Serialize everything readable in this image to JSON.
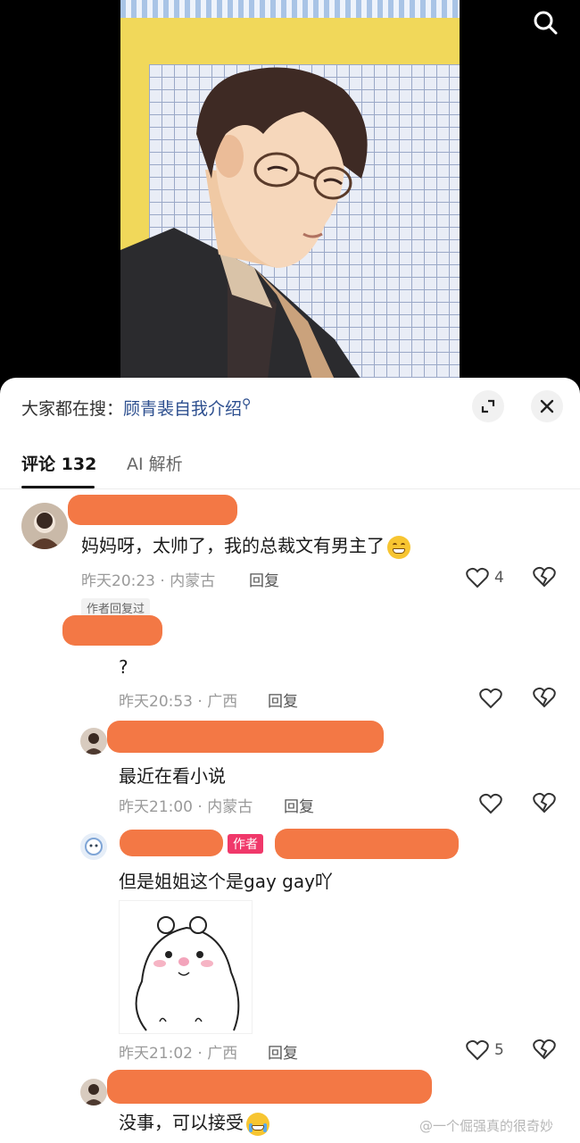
{
  "search_bar": {
    "prefix": "大家都在搜：",
    "keyword": "顾青裴自我介绍",
    "search_mark": "⚲"
  },
  "tabs": {
    "comments_label": "评论",
    "comments_count": "132",
    "ai_label": "AI 解析"
  },
  "comments": [
    {
      "text": "妈妈呀，太帅了，我的总裁文有男主了",
      "emoji": "grinning-face",
      "time": "昨天20:23",
      "location": "内蒙古",
      "reply_label": "回复",
      "likes": "4",
      "author_replied_tag": "作者回复过"
    },
    {
      "text": "?",
      "time": "昨天20:53",
      "location": "广西",
      "reply_label": "回复",
      "likes": ""
    },
    {
      "text": "最近在看小说",
      "time": "昨天21:00",
      "location": "内蒙古",
      "reply_label": "回复",
      "likes": ""
    },
    {
      "author_badge": "作者",
      "text": "但是姐姐这个是gay gay吖",
      "sticker": "hamster-sticker",
      "time": "昨天21:02",
      "location": "广西",
      "reply_label": "回复",
      "likes": "5"
    },
    {
      "text": "没事，可以接受",
      "emoji": "laughing-crying-face"
    }
  ],
  "meta_separator": " · ",
  "watermark": "@一个倔强真的很奇妙",
  "colors": {
    "redaction": "#f37845",
    "keyword": "#2d4f8f",
    "author_badge": "#f0386a"
  }
}
